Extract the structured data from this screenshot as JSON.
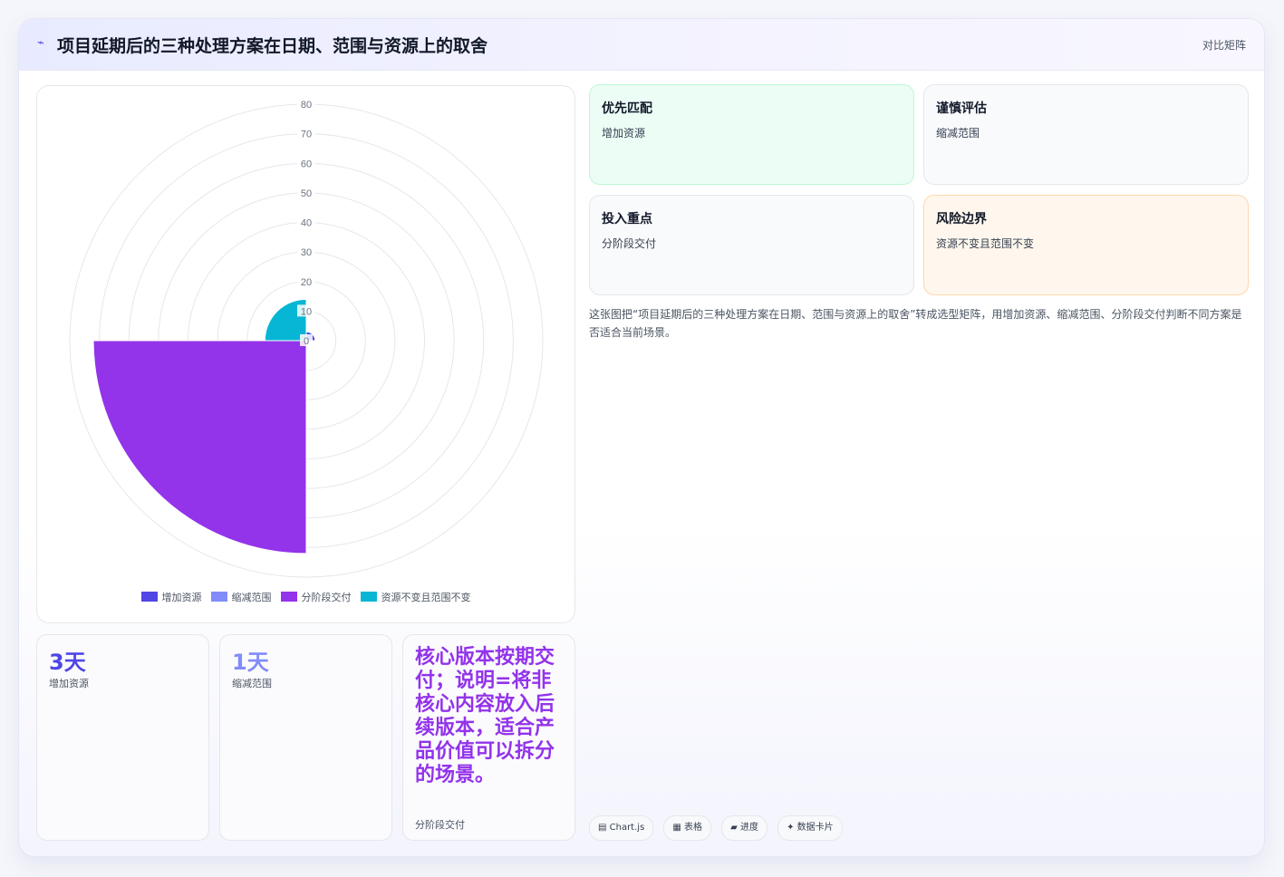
{
  "header": {
    "icon": "trend-line-icon",
    "title": "项目延期后的三种处理方案在日期、范围与资源上的取舍",
    "tag": "对比矩阵"
  },
  "chart_data": {
    "type": "polarArea",
    "categories": [
      "增加资源",
      "缩减范围",
      "分阶段交付",
      "资源不变且范围不变"
    ],
    "values": [
      3,
      1,
      72,
      14
    ],
    "colors": [
      "#4f46e5",
      "#818cf8",
      "#9333ea",
      "#06b6d4"
    ],
    "r_ticks": [
      "0",
      "10",
      "20",
      "30",
      "40",
      "50",
      "60",
      "70",
      "80"
    ],
    "r_range": [
      0,
      80
    ],
    "legend_position": "bottom"
  },
  "stats": [
    {
      "value": "3天",
      "label": "增加资源",
      "color": "#4f46e5"
    },
    {
      "value": "1天",
      "label": "缩减范围",
      "color": "#818cf8"
    },
    {
      "value": "核心版本按期交付；说明=将非核心内容放入后续版本，适合产品价值可以拆分的场景。",
      "label": "分阶段交付",
      "color": "#9333ea"
    }
  ],
  "matrix": [
    {
      "title": "优先匹配",
      "sub": "增加资源",
      "bg": "#ecfdf5",
      "border": "#bbf7d0"
    },
    {
      "title": "谨慎评估",
      "sub": "缩减范围",
      "bg": "#f9fafc",
      "border": "#e5e7eb"
    },
    {
      "title": "投入重点",
      "sub": "分阶段交付",
      "bg": "#f9fafc",
      "border": "#e5e7eb"
    },
    {
      "title": "风险边界",
      "sub": "资源不变且范围不变",
      "bg": "#fff7ed",
      "border": "#fed7aa"
    }
  ],
  "description": "这张图把“项目延期后的三种处理方案在日期、范围与资源上的取舍”转成选型矩阵，用增加资源、缩减范围、分阶段交付判断不同方案是否适合当前场景。",
  "chips": [
    "▤ Chart.js",
    "▦ 表格",
    "▰ 进度",
    "✦ 数据卡片"
  ]
}
